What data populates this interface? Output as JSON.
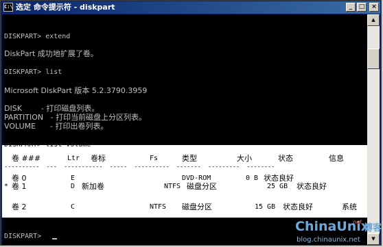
{
  "window": {
    "icon_text": "C:\\",
    "title": "选定 命令提示符 - diskpart",
    "buttons": {
      "minimize": "_",
      "maximize": "□",
      "close": "×"
    }
  },
  "console": {
    "lines": [
      "DISKPART> extend",
      "DiskPart 成功地扩展了卷。",
      "DISKPART> list",
      "Microsoft DiskPart 版本 5.2.3790.3959",
      "DISK        - 打印磁盘列表。",
      "PARTITION   - 打印当前磁盘上分区列表。",
      "VOLUME      - 打印出卷列表。",
      "DISKPART> list volume"
    ],
    "prompt": "DISKPART> "
  },
  "volume_table": {
    "headers": [
      "卷 ###",
      "Ltr",
      "卷标",
      "Fs",
      "类型",
      "大小",
      "状态",
      "信息"
    ],
    "separator": "----------  ---  -----------  -----  ----------  -------  ---------  --------",
    "rows": [
      {
        "marker": "",
        "vol": "卷 0",
        "ltr": "E",
        "label": "",
        "fs": "",
        "type": "DVD-ROM",
        "size": "0 B",
        "status": "状态良好",
        "info": ""
      },
      {
        "marker": "*",
        "vol": "卷 1",
        "ltr": "D",
        "label": "新加卷",
        "fs": "NTFS",
        "type": "磁盘分区",
        "size": "25 GB",
        "status": "状态良好",
        "info": ""
      },
      {
        "marker": "",
        "vol": "卷 2",
        "ltr": "C",
        "label": "",
        "fs": "NTFS",
        "type": "磁盘分区",
        "size": "15 GB",
        "status": "状态良好",
        "info": "系统"
      }
    ]
  },
  "scrollbar": {
    "up": "▲",
    "down": "▼"
  },
  "watermark": {
    "brand": "ChinaUnix",
    "superscript": ".net",
    "cn": "博客",
    "url": "blog.chinaunix.net"
  }
}
